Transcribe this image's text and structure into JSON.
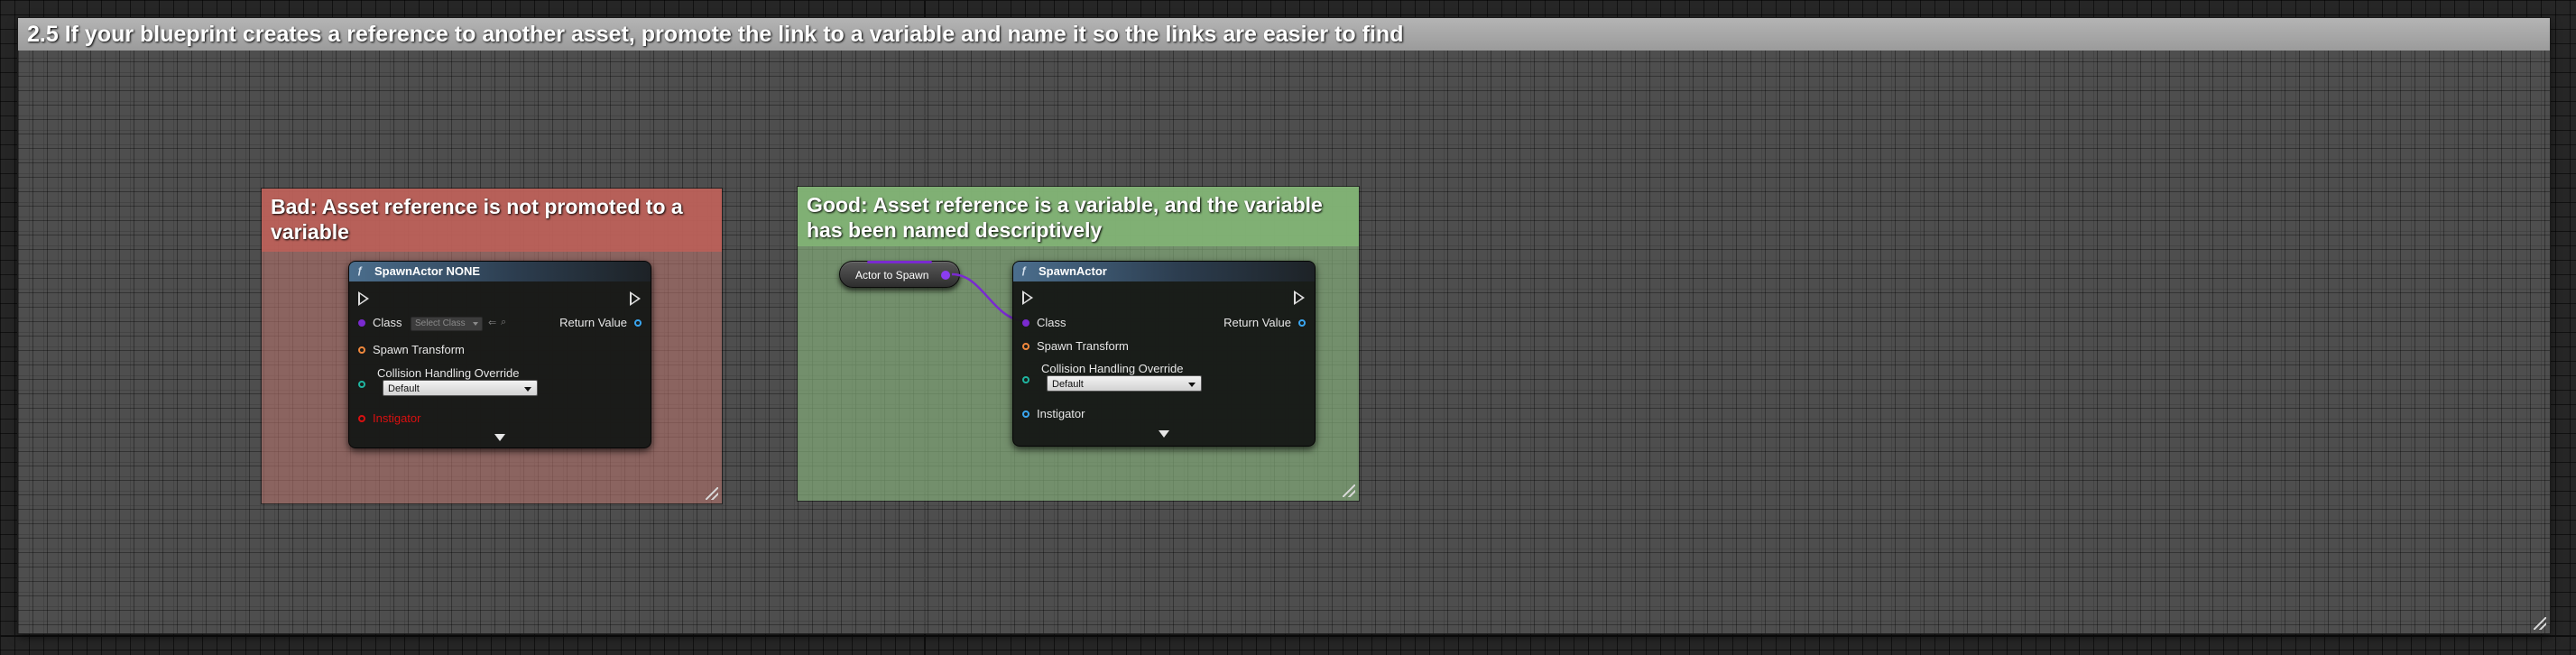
{
  "main_comment": {
    "title": "2.5 If your blueprint creates a reference to another asset, promote the link to a variable and name it so the links are easier to find"
  },
  "bad_example": {
    "comment": "Bad: Asset reference is not promoted to a variable",
    "node": {
      "title": "SpawnActor NONE",
      "class_label": "Class",
      "class_placeholder": "Select Class",
      "return_label": "Return Value",
      "spawn_transform_label": "Spawn Transform",
      "collision_label": "Collision Handling Override",
      "collision_value": "Default",
      "instigator_label": "Instigator"
    }
  },
  "good_example": {
    "comment": "Good: Asset reference is a variable, and the variable has been named descriptively",
    "variable": {
      "label": "Actor to Spawn"
    },
    "node": {
      "title": "SpawnActor",
      "class_label": "Class",
      "return_label": "Return Value",
      "spawn_transform_label": "Spawn Transform",
      "collision_label": "Collision Handling Override",
      "collision_value": "Default",
      "instigator_label": "Instigator"
    }
  },
  "colors": {
    "class_pin": "#7a2ad0",
    "transform_pin": "#f0883c",
    "collision_pin": "#1fb5a0",
    "object_pin": "#3aa6f0",
    "error_text": "#d81010",
    "wire": "#7a2ad0"
  }
}
